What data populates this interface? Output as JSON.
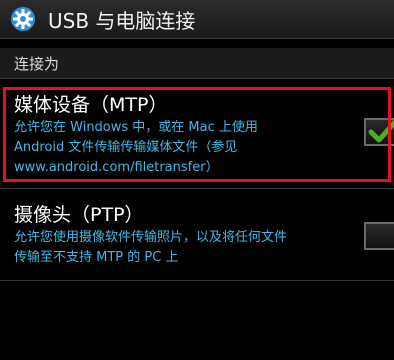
{
  "header": {
    "title": "USB 与电脑连接",
    "icon": "gear-icon"
  },
  "section": {
    "label": "连接为"
  },
  "options": [
    {
      "title": "媒体设备（MTP）",
      "description_lines": [
        "允许您在 Windows 中，或在 Mac 上使用",
        "Android 文件传输传输媒体文件（参见",
        "www.android.com/filetransfer）"
      ],
      "checked": true
    },
    {
      "title": "摄像头（PTP）",
      "description_lines": [
        "允许您使用摄像软件传输照片，以及将任何文件",
        "传输至不支持 MTP 的 PC 上"
      ],
      "checked": false
    }
  ],
  "colors": {
    "description": "#41b8e8",
    "highlight": "#e8101e",
    "check": "#4caf1f"
  }
}
